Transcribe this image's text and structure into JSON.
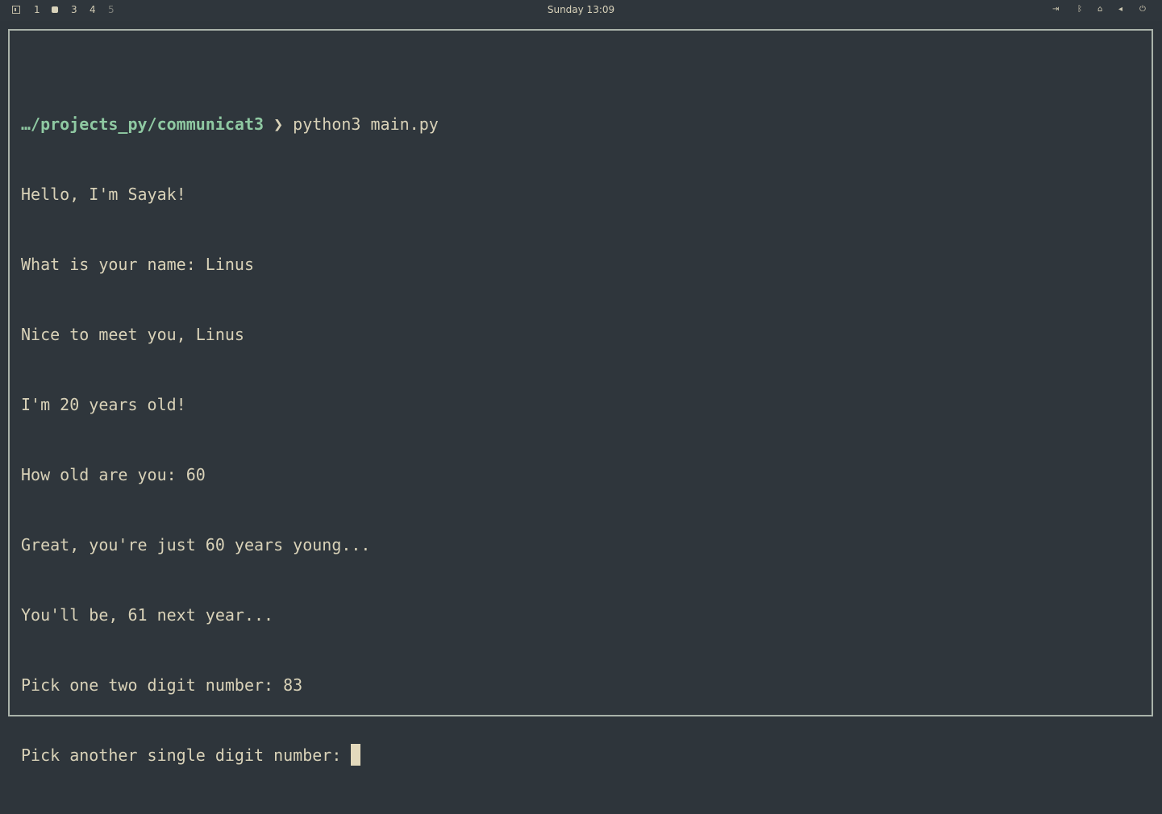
{
  "topbar": {
    "workspaces": [
      "1",
      "3",
      "4",
      "5"
    ],
    "clock": "Sunday 13:09",
    "tray_icons": [
      "logout-icon",
      "bluetooth-icon",
      "network-icon",
      "volume-icon",
      "power-icon"
    ]
  },
  "terminal": {
    "prompt_path": "…/projects_py/communicat3",
    "prompt_symbol": "❯",
    "command": "python3 main.py",
    "lines": [
      "Hello, I'm Sayak!",
      "What is your name: Linus",
      "Nice to meet you, Linus",
      "I'm 20 years old!",
      "How old are you: 60",
      "Great, you're just 60 years young...",
      "You'll be, 61 next year...",
      "Pick one two digit number: 83",
      "Pick another single digit number: "
    ]
  },
  "colors": {
    "background": "#2f363c",
    "text": "#d9d2b8",
    "prompt": "#8fc9a2",
    "border": "#aab3aa"
  }
}
